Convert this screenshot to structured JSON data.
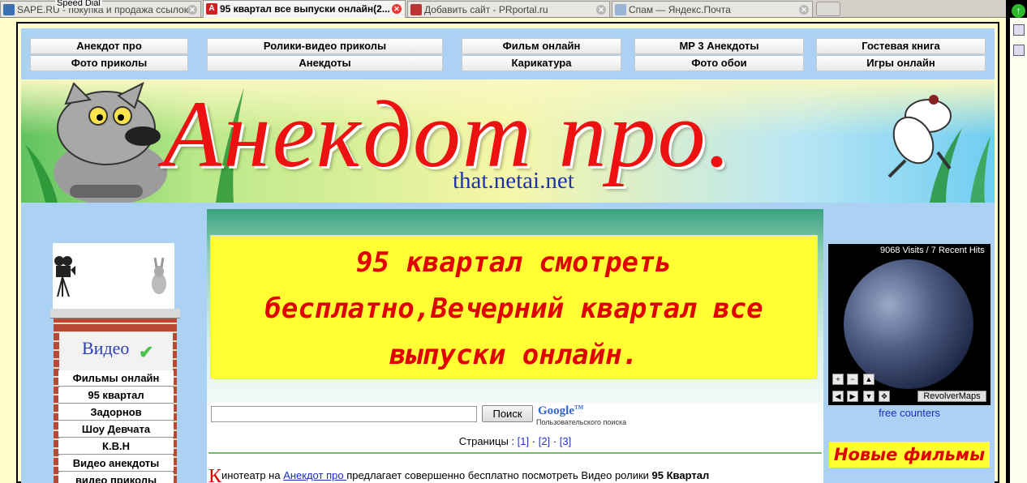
{
  "browser": {
    "tabs": [
      {
        "title": "SAPE.RU - покупка и продажа ссылок...",
        "active": false
      },
      {
        "title": "95 квартал все выпуски онлайн(2...",
        "active": true
      },
      {
        "title": "Добавить сайт - PRportal.ru",
        "active": false
      },
      {
        "title": "Спам — Яндекс.Почта",
        "active": false
      }
    ],
    "speed_dial": "Speed Dial"
  },
  "nav": {
    "items": [
      {
        "label": "Анекдот про"
      },
      {
        "label": "Ролики-видео приколы"
      },
      {
        "label": "Фильм онлайн"
      },
      {
        "label": "MP 3 Анекдоты"
      },
      {
        "label": "Гостевая книга"
      },
      {
        "label": "Фото приколы"
      },
      {
        "label": "Анекдоты"
      },
      {
        "label": "Карикатура"
      },
      {
        "label": "Фото обои"
      },
      {
        "label": "Игры онлайн"
      }
    ]
  },
  "banner": {
    "title": "Анекдот про.",
    "subtitle": "that.netai.net"
  },
  "sidebar": {
    "header": "Видео",
    "items": [
      {
        "label": "Фильмы онлайн"
      },
      {
        "label": "95 квартал"
      },
      {
        "label": "Задорнов"
      },
      {
        "label": "Шоу Девчата"
      },
      {
        "label": "К.В.Н"
      },
      {
        "label": "Видео анекдоты"
      },
      {
        "label": "видео приколы"
      }
    ]
  },
  "main": {
    "headline": "95 квартал смотреть бесплатно,Вечерний квартал все выпуски онлайн.",
    "search": {
      "value": "",
      "button": "Поиск",
      "logo": "Google",
      "logo_sub": "Пользовательского поиска"
    },
    "pages": {
      "label": "Страницы :",
      "links": [
        "[1]",
        "[2]",
        "[3]"
      ],
      "sep": "·"
    },
    "intro": {
      "first_letter": "К",
      "text_before": "инотеатр на ",
      "link": "Анекдот про ",
      "text_after": "предлагает совершенно бесплатно посмотреть Видео ролики ",
      "bold": "95 Квартал"
    }
  },
  "right": {
    "visits": "9068 Visits / 7 Recent Hits",
    "revolver": "RevolverMaps",
    "free_counters": "free counters",
    "new_films": "Новые фильмы"
  },
  "colors": {
    "page_bg": "#ffffcc",
    "panel_bg": "#abd2f2",
    "headline_bg": "#ffff33",
    "headline_text": "#e00000",
    "link": "#1a2ec0"
  }
}
